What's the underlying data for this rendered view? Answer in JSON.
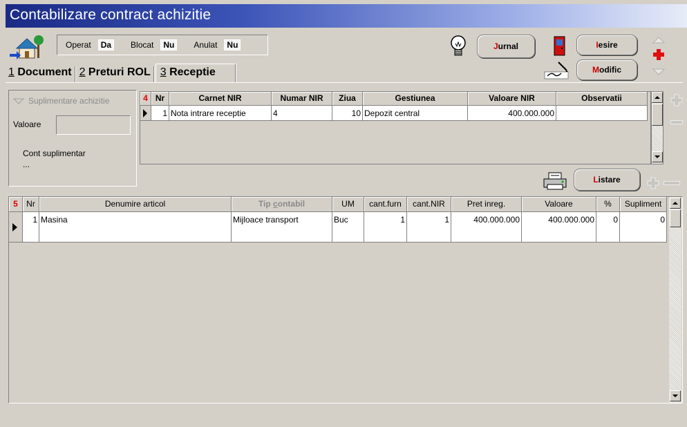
{
  "window": {
    "title": "Contabilizare contract achizitie"
  },
  "flags": [
    {
      "label": "Operat",
      "value": "Da"
    },
    {
      "label": "Blocat",
      "value": "Nu"
    },
    {
      "label": "Anulat",
      "value": "Nu"
    }
  ],
  "toolbar": {
    "jurnal": {
      "hot": "J",
      "rest": "urnal"
    },
    "iesire": {
      "hot": "I",
      "rest": "esire"
    },
    "modific": {
      "hot": "M",
      "rest": "odific"
    },
    "listare": {
      "hot": "L",
      "rest": "istare"
    }
  },
  "tabs": [
    {
      "num": "1",
      "label": " Document"
    },
    {
      "num": "2",
      "label": " Preturi ROL"
    },
    {
      "num": "3",
      "label": " Receptie"
    }
  ],
  "suplimentare": {
    "title": "Suplimentare achizitie",
    "valoare_label": "Valoare",
    "valoare_value": "",
    "cont_label": "Cont suplimentar",
    "cont_value": "..."
  },
  "grid_nir": {
    "badge": "4",
    "columns": [
      "Nr",
      "Carnet NIR",
      "Numar NIR",
      "Ziua",
      "Gestiunea",
      "Valoare NIR",
      "Observatii"
    ],
    "rows": [
      {
        "nr": "1",
        "carnet": "Nota intrare receptie",
        "numar": "4",
        "ziua": "10",
        "gestiunea": "Depozit central",
        "valoare": "400.000.000",
        "observatii": ""
      }
    ]
  },
  "grid_articole": {
    "badge": "5",
    "columns": [
      "Nr",
      "Denumire articol",
      "Tip contabil",
      "UM",
      "cant.furn",
      "cant.NIR",
      "Pret inreg.",
      "Valoare",
      "%",
      "Supliment"
    ],
    "rows": [
      {
        "nr": "1",
        "denumire": "Masina",
        "tip": "Mijloace transport",
        "um": "Buc",
        "cant_furn": "1",
        "cant_nir": "1",
        "pret": "400.000.000",
        "valoare": "400.000.000",
        "procent": "0",
        "supliment": "0"
      }
    ]
  },
  "colors": {
    "title_start": "#1a2a85",
    "title_end": "#e8ecf8",
    "hotkey": "#d00000",
    "badge": "#e00000"
  }
}
